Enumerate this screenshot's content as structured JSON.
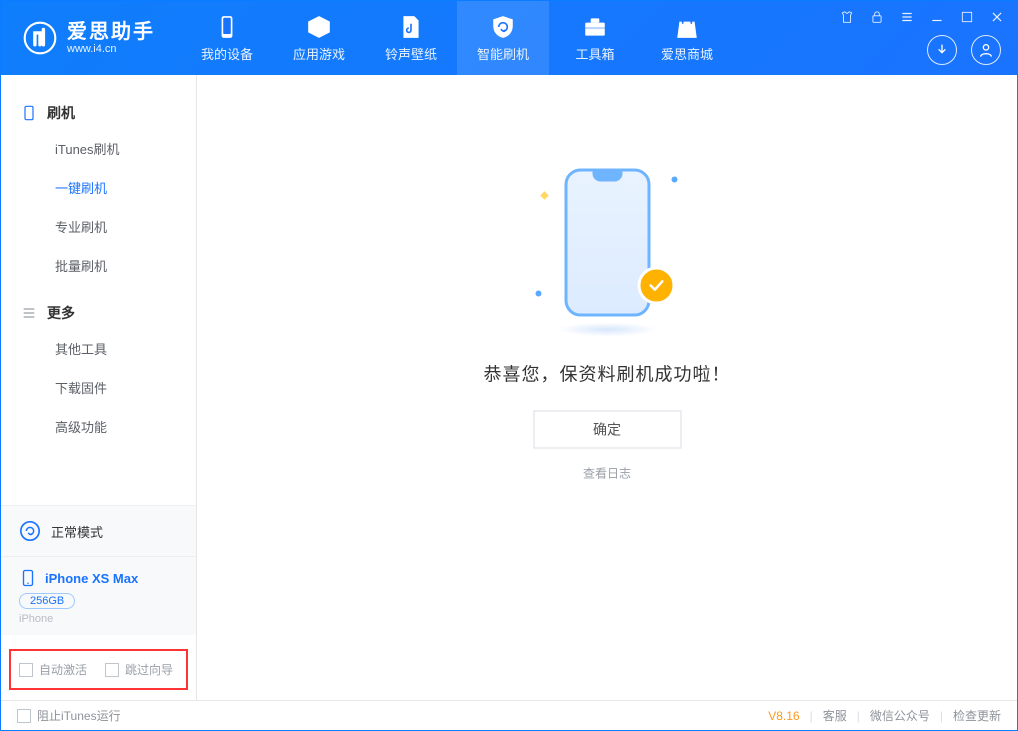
{
  "brand": {
    "cn": "爱思助手",
    "en": "www.i4.cn"
  },
  "tabs": [
    {
      "id": "device",
      "label": "我的设备"
    },
    {
      "id": "apps",
      "label": "应用游戏"
    },
    {
      "id": "ring",
      "label": "铃声壁纸"
    },
    {
      "id": "flash",
      "label": "智能刷机"
    },
    {
      "id": "tools",
      "label": "工具箱"
    },
    {
      "id": "store",
      "label": "爱思商城"
    }
  ],
  "sidebar": {
    "group_flash": "刷机",
    "items_flash": [
      {
        "label": "iTunes刷机"
      },
      {
        "label": "一键刷机"
      },
      {
        "label": "专业刷机"
      },
      {
        "label": "批量刷机"
      }
    ],
    "group_more": "更多",
    "items_more": [
      {
        "label": "其他工具"
      },
      {
        "label": "下载固件"
      },
      {
        "label": "高级功能"
      }
    ],
    "mode_label": "正常模式",
    "device": {
      "name": "iPhone XS Max",
      "storage": "256GB",
      "type": "iPhone"
    },
    "chk_auto_activate": "自动激活",
    "chk_skip_guide": "跳过向导"
  },
  "main": {
    "success_msg": "恭喜您，保资料刷机成功啦！",
    "ok_button": "确定",
    "view_log": "查看日志"
  },
  "footer": {
    "block_itunes": "阻止iTunes运行",
    "version": "V8.16",
    "support": "客服",
    "wechat": "微信公众号",
    "update": "检查更新"
  }
}
